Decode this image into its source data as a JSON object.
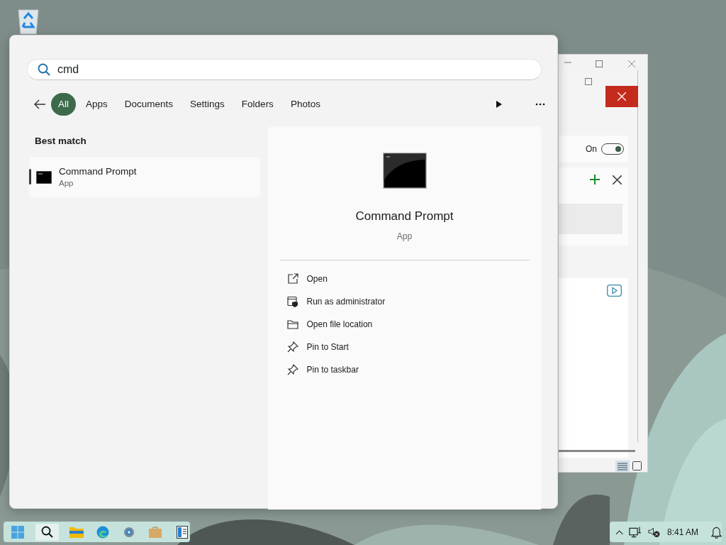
{
  "search": {
    "value": "cmd"
  },
  "filters": [
    {
      "label": "All",
      "selected": true
    },
    {
      "label": "Apps",
      "selected": false
    },
    {
      "label": "Documents",
      "selected": false
    },
    {
      "label": "Settings",
      "selected": false
    },
    {
      "label": "Folders",
      "selected": false
    },
    {
      "label": "Photos",
      "selected": false
    }
  ],
  "section_title": "Best match",
  "results": [
    {
      "name": "Command Prompt",
      "type": "App",
      "selected": true
    }
  ],
  "detail": {
    "name": "Command Prompt",
    "type": "App",
    "actions": [
      {
        "label": "Open",
        "kind": "open"
      },
      {
        "label": "Run as administrator",
        "kind": "admin"
      },
      {
        "label": "Open file location",
        "kind": "folder"
      },
      {
        "label": "Pin to Start",
        "kind": "pin"
      },
      {
        "label": "Pin to taskbar",
        "kind": "pin"
      }
    ]
  },
  "background_window": {
    "toggle": {
      "label": "On",
      "on": true
    }
  },
  "tray": {
    "time": "8:41 AM"
  }
}
